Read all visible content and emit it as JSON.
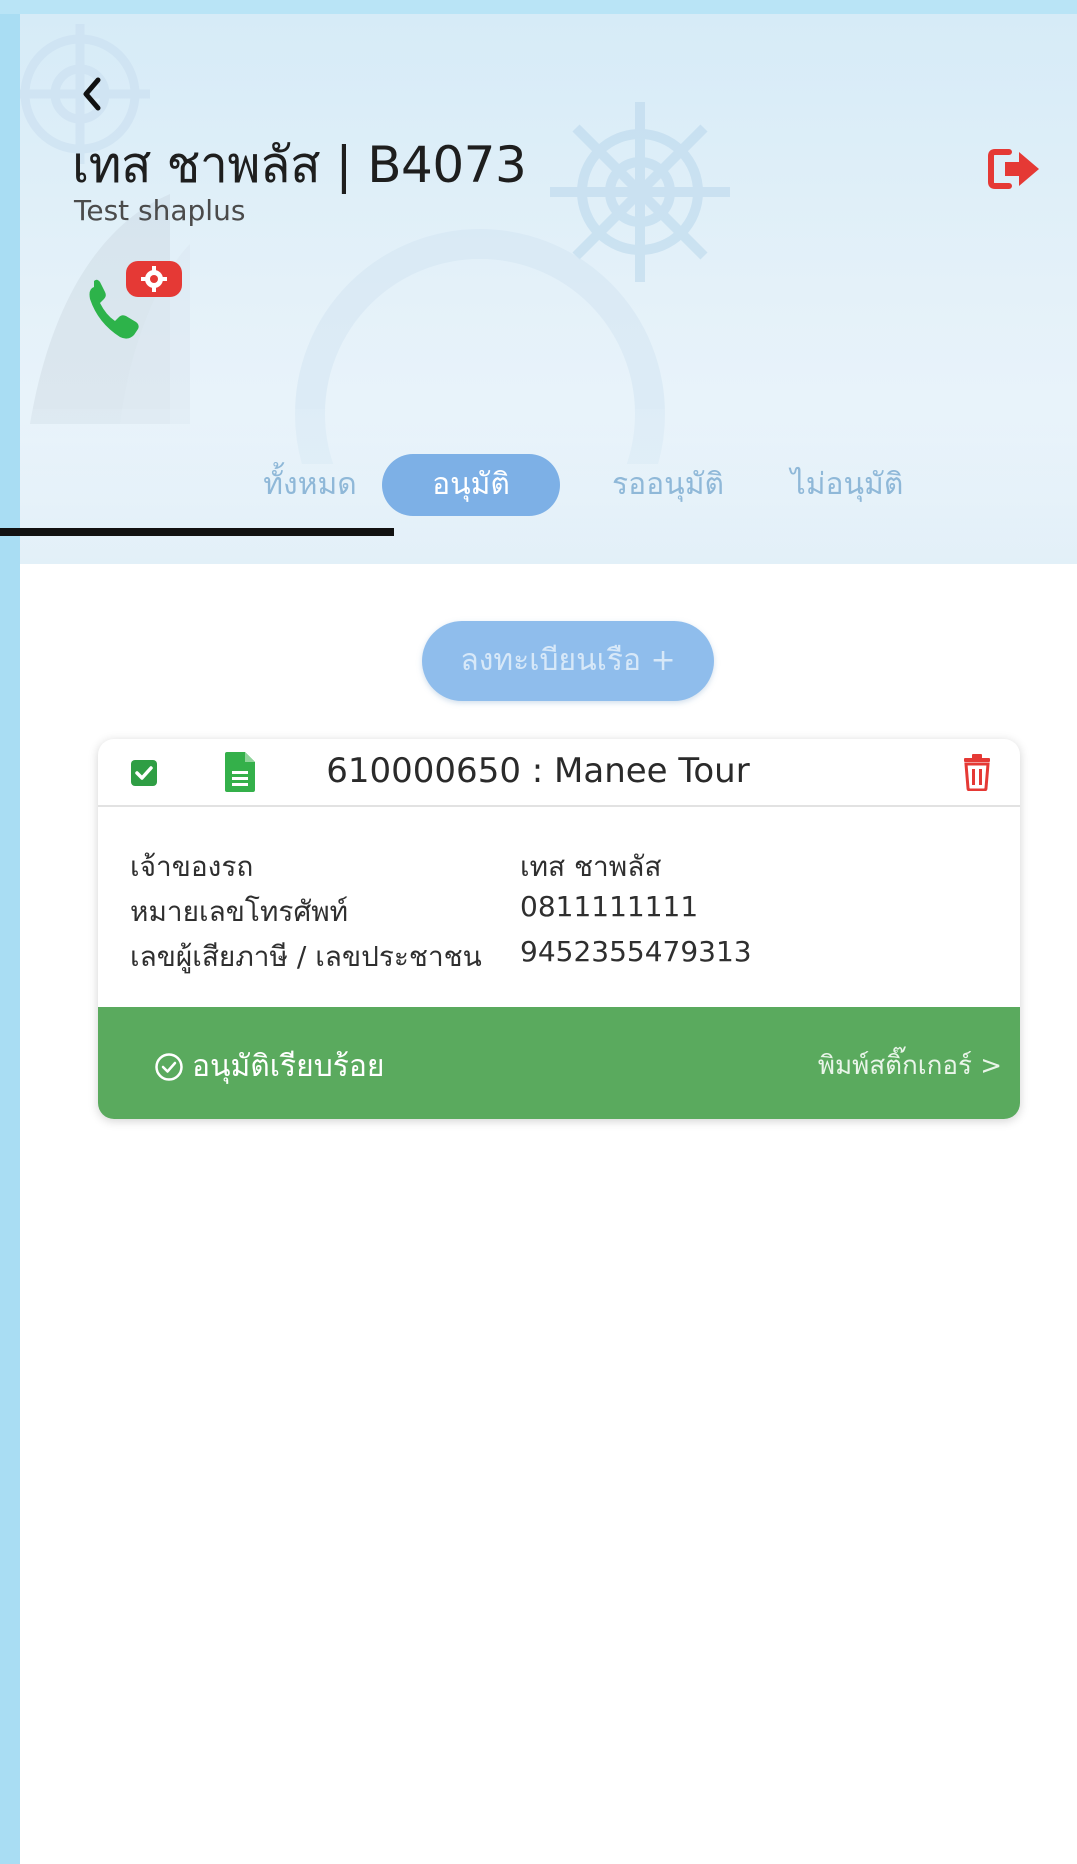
{
  "header": {
    "title": "เทส ชาพลัส | B4073",
    "subtitle": "Test shaplus"
  },
  "tabs": [
    {
      "label": "ทั้งหมด"
    },
    {
      "label": "อนุมัติ"
    },
    {
      "label": "รออนุมัติ"
    },
    {
      "label": "ไม่อนุมัติ"
    }
  ],
  "register_button": {
    "label": "ลงทะเบียนเรือ +"
  },
  "card": {
    "title": "610000650 : Manee Tour",
    "rows": [
      {
        "label": "เจ้าของรถ",
        "value": "เทส ชาพลัส"
      },
      {
        "label": "หมายเลขโทรศัพท์",
        "value": "0811111111"
      },
      {
        "label": "เลขผู้เสียภาษี / เลขประชาชน",
        "value": "9452355479313"
      }
    ],
    "status": "อนุมัติเรียบร้อย",
    "print_link": "พิมพ์สติ๊กเกอร์ >"
  },
  "colors": {
    "tab_active": "#7db0e6",
    "status_green": "#5aaa5e",
    "logout_red": "#e53935",
    "phone_green": "#2db34a",
    "checkbox_green": "#2f9e44"
  }
}
